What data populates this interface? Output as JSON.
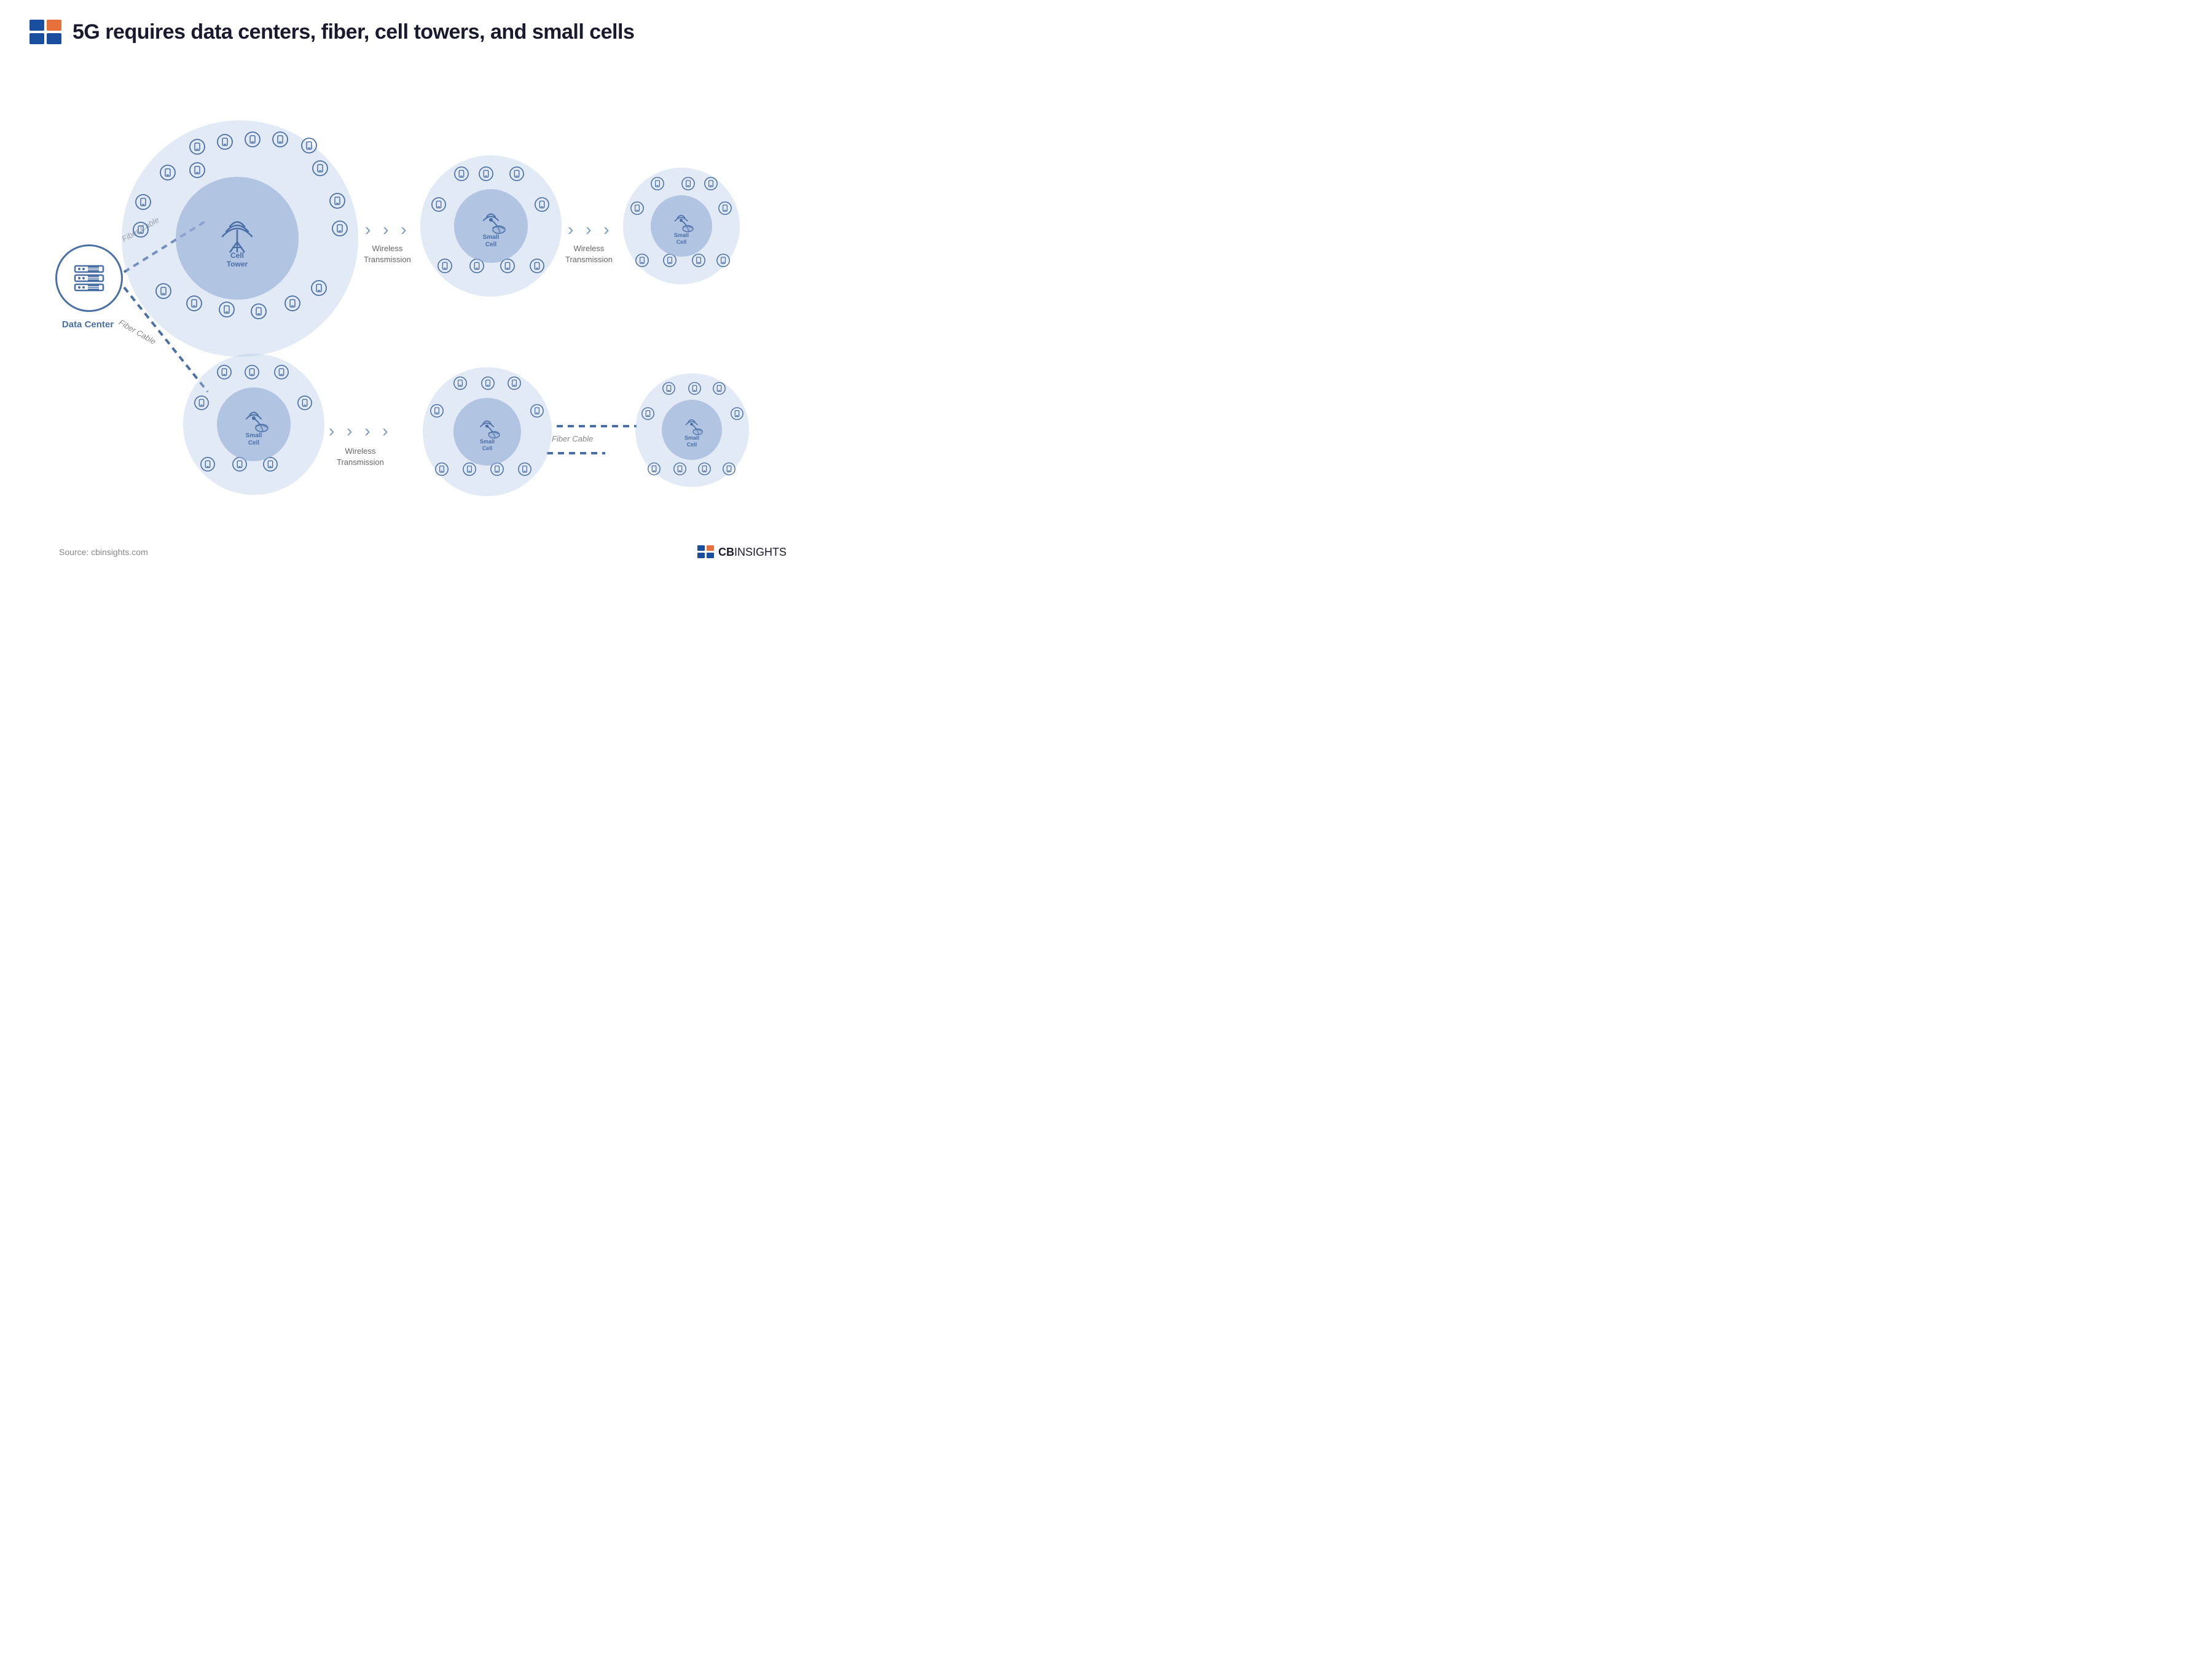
{
  "header": {
    "title": "5G requires data centers, fiber, cell towers, and small cells"
  },
  "nodes": {
    "data_center": {
      "label": "Data\nCenter"
    },
    "cell_tower": {
      "label": "Cell\nTower"
    },
    "small_cell": "Small\nCell"
  },
  "connections": {
    "fiber_cable_1": "Fiber Cable",
    "fiber_cable_2": "Fiber Cable",
    "fiber_cable_3": "Fiber Cable",
    "wireless_1": "Wireless\nTransmission",
    "wireless_2": "Wireless\nTransmission",
    "wireless_3": "Wireless\nTransmission"
  },
  "footer": {
    "source": "Source: cbinsights.com",
    "logo_text": "CBINSIGHTS"
  }
}
